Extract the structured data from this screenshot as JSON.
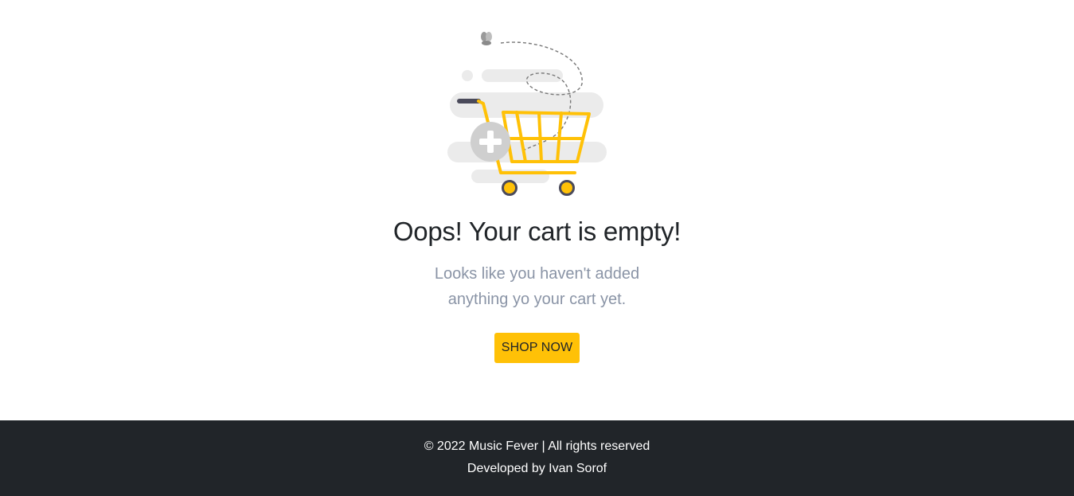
{
  "empty_cart": {
    "title": "Oops! Your cart is empty!",
    "subtitle_line1": "Looks like you haven't added",
    "subtitle_line2": "anything yo your cart yet.",
    "button_label": "SHOP NOW"
  },
  "footer": {
    "copyright": "© 2022 Music Fever | All rights reserved",
    "credit": "Developed by Ivan Sorof"
  },
  "colors": {
    "accent": "#ffc107",
    "footer_bg": "#212529",
    "title_text": "#212529",
    "subtitle_text": "#8a94a6",
    "cart_yellow": "#ffc107",
    "cloud_gray": "#ebebeb"
  },
  "icons": [
    "empty-cart-illustration",
    "shopping-cart-icon",
    "plus-icon",
    "butterfly-icon"
  ]
}
